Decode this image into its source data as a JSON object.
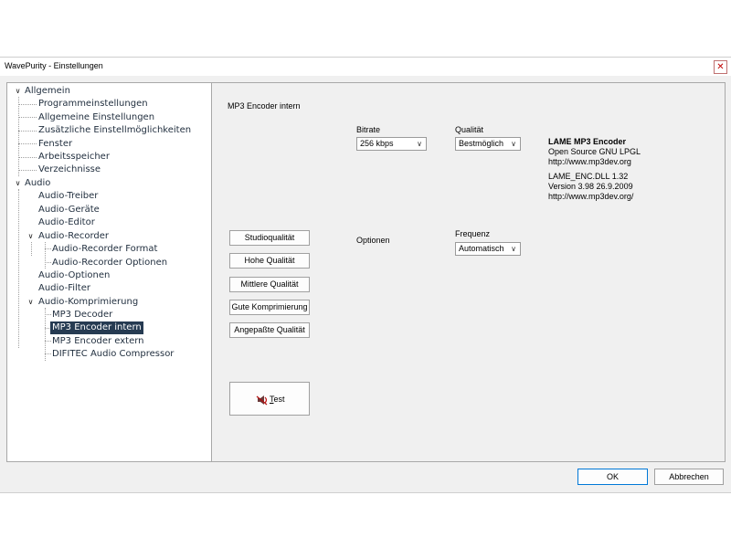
{
  "window": {
    "title": "WavePurity - Einstellungen",
    "close_glyph": "✕"
  },
  "tree": {
    "items": [
      {
        "label": "Allgemein",
        "level": 0,
        "expanded": true
      },
      {
        "label": "Programmeinstellungen",
        "level": 1
      },
      {
        "label": "Allgemeine Einstellungen",
        "level": 1
      },
      {
        "label": "Zusätzliche Einstellmöglichkeiten",
        "level": 1
      },
      {
        "label": "Fenster",
        "level": 1
      },
      {
        "label": "Arbeitsspeicher",
        "level": 1
      },
      {
        "label": "Verzeichnisse",
        "level": 1
      },
      {
        "label": "Audio",
        "level": 0,
        "expanded": true
      },
      {
        "label": "Audio-Treiber",
        "level": 1
      },
      {
        "label": "Audio-Geräte",
        "level": 1
      },
      {
        "label": "Audio-Editor",
        "level": 1
      },
      {
        "label": "Audio-Recorder",
        "level": 1,
        "expanded": true
      },
      {
        "label": "Audio-Recorder Format",
        "level": 2
      },
      {
        "label": "Audio-Recorder Optionen",
        "level": 2
      },
      {
        "label": "Audio-Optionen",
        "level": 1
      },
      {
        "label": "Audio-Filter",
        "level": 1
      },
      {
        "label": "Audio-Komprimierung",
        "level": 1,
        "expanded": true
      },
      {
        "label": "MP3 Decoder",
        "level": 2
      },
      {
        "label": "MP3 Encoder intern",
        "level": 2,
        "selected": true
      },
      {
        "label": "MP3 Encoder extern",
        "level": 2
      },
      {
        "label": "DIFITEC Audio Compressor",
        "level": 2
      }
    ]
  },
  "main": {
    "section_title": "MP3 Encoder intern",
    "bitrate": {
      "label": "Bitrate",
      "value": "256 kbps"
    },
    "quality": {
      "label": "Qualität",
      "value": "Bestmöglich"
    },
    "info": {
      "name": "LAME MP3 Encoder",
      "license": "Open Source GNU LPGL",
      "url1": "http://www.mp3dev.org",
      "dll": "LAME_ENC.DLL  1.32",
      "version": "Version 3.98   26.9.2009",
      "url2": "http://www.mp3dev.org/"
    },
    "presets": [
      "Studioqualität",
      "Hohe Qualität",
      "Mittlere Qualität",
      "Gute Komprimierung",
      "Angepaßte Qualität"
    ],
    "options_label": "Optionen",
    "frequency": {
      "label": "Frequenz",
      "value": "Automatisch"
    },
    "test": {
      "mnemonic": "T",
      "rest": "est"
    }
  },
  "footer": {
    "ok": "OK",
    "cancel": "Abbrechen"
  },
  "colors": {
    "selection": "#263b52",
    "ok_border": "#0078d7"
  }
}
